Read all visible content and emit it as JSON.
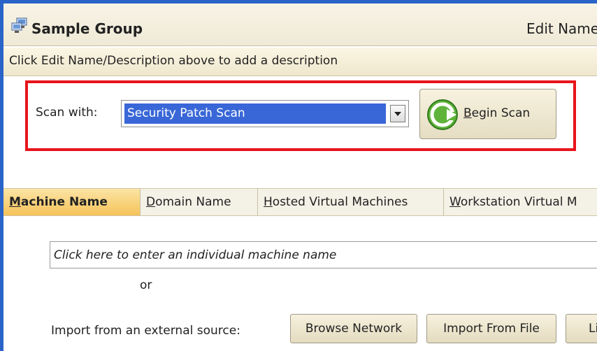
{
  "header": {
    "group_title": "Sample Group",
    "edit_link": "Edit Name",
    "description": "Click Edit Name/Description above to add a description"
  },
  "scan": {
    "label": "Scan with:",
    "selected_template": "Security Patch Scan",
    "begin_button_label": "egin Scan",
    "begin_button_accesskey": "B"
  },
  "tabs": [
    {
      "label_first": "M",
      "label_rest": "achine Name",
      "active": true
    },
    {
      "label_first": "D",
      "label_rest": "omain Name",
      "active": false
    },
    {
      "label_first": "H",
      "label_rest": "osted Virtual Machines",
      "active": false
    },
    {
      "label_first": "W",
      "label_rest": "orkstation Virtual M",
      "active": false
    }
  ],
  "machine_panel": {
    "input_placeholder": "Click here to enter an individual machine name",
    "or_text": "or",
    "import_label": "Import from an external source:",
    "browse_network_label": "Browse Network",
    "import_from_file_label": "Import From File",
    "list_button_label": "Li"
  },
  "colors": {
    "window_border": "#2a64c8",
    "highlight_border": "#e8141c",
    "selection_bg": "#3967d8",
    "active_tab": "#f5c35a"
  }
}
